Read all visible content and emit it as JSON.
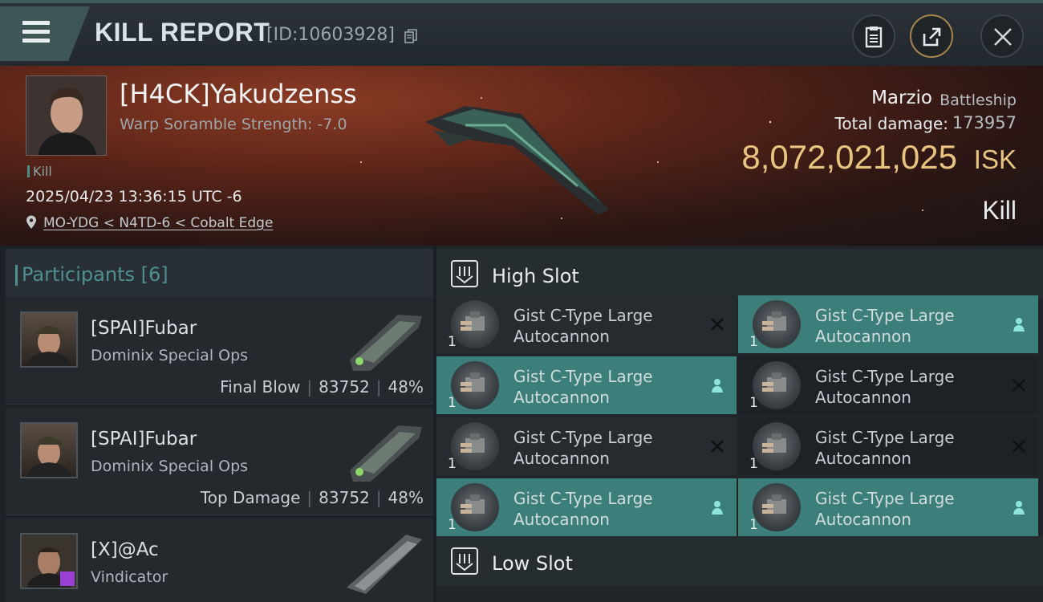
{
  "header": {
    "title": "KILL REPORT",
    "report_id": "[ID:10603928]"
  },
  "victim": {
    "name": "[H4CK]Yakudzenss",
    "scramble": "Warp Soramble Strength: -7.0",
    "kill_tag": "Kill",
    "timestamp": "2025/04/23 13:36:15 UTC -6",
    "location": "MO-YDG < N4TD-6 < Cobalt Edge",
    "ship_name": "Marzio",
    "ship_class": "Battleship",
    "total_damage_label": "Total damage:",
    "total_damage_value": "173957",
    "isk_value": "8,072,021,025",
    "isk_unit": "ISK",
    "result": "Kill"
  },
  "participants": {
    "header": "Participants",
    "count": "[6]",
    "items": [
      {
        "name": "[SPAI]Fubar",
        "ship": "Dominix Special Ops",
        "role": "Final Blow",
        "damage": "83752",
        "pct": "48%"
      },
      {
        "name": "[SPAI]Fubar",
        "ship": "Dominix Special Ops",
        "role": "Top Damage",
        "damage": "83752",
        "pct": "48%"
      },
      {
        "name": "[X]@Ac",
        "ship": "Vindicator",
        "role": "",
        "damage": "",
        "pct": ""
      }
    ]
  },
  "slots": {
    "high_label": "High Slot",
    "low_label": "Low Slot",
    "high_modules": [
      {
        "name": "Gist C-Type Large Autocannon",
        "qty": "1",
        "status": "destroyed"
      },
      {
        "name": "Gist C-Type Large Autocannon",
        "qty": "1",
        "status": "dropped"
      },
      {
        "name": "Gist C-Type Large Autocannon",
        "qty": "1",
        "status": "dropped"
      },
      {
        "name": "Gist C-Type Large Autocannon",
        "qty": "1",
        "status": "destroyed"
      },
      {
        "name": "Gist C-Type Large Autocannon",
        "qty": "1",
        "status": "destroyed"
      },
      {
        "name": "Gist C-Type Large Autocannon",
        "qty": "1",
        "status": "destroyed"
      },
      {
        "name": "Gist C-Type Large Autocannon",
        "qty": "1",
        "status": "dropped"
      },
      {
        "name": "Gist C-Type Large Autocannon",
        "qty": "1",
        "status": "dropped"
      }
    ]
  },
  "colors": {
    "accent_teal": "#3b7e7a",
    "isk_gold": "#e9c47f",
    "hero_red": "#5a2418"
  },
  "icons": {
    "menu": "hamburger-menu-icon",
    "copy": "copy-icon",
    "clipboard": "clipboard-icon",
    "share": "share-icon",
    "close": "close-icon",
    "location": "location-pin-icon",
    "slot": "slot-icon",
    "destroyed": "destroyed-x-icon",
    "dropped": "dropped-person-icon"
  }
}
